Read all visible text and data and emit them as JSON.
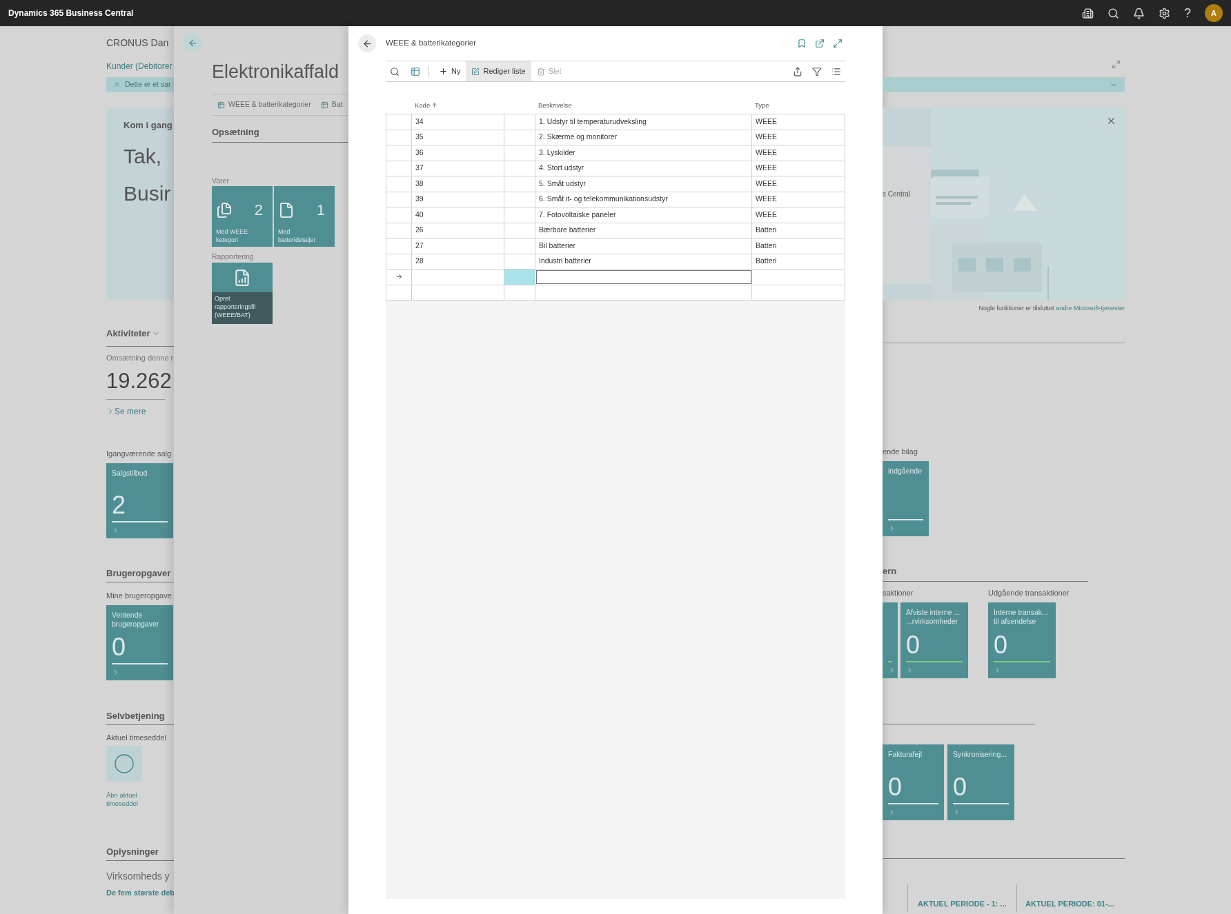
{
  "top_bar": {
    "title": "Dynamics 365 Business Central",
    "help": "?",
    "avatar": "A"
  },
  "home_left": {
    "company": "CRONUS Dan",
    "nav_link": "Kunder (Debitorer",
    "banner": "Dette er et sar",
    "kicker": "Kom i gang",
    "heading": [
      "Tak,",
      "Busir"
    ],
    "activities": {
      "title": "Aktiviteter",
      "caption": "Omsætning denne r",
      "value": "19.262",
      "link": "Se mere"
    },
    "sales": {
      "caption": "Igangværende salg",
      "tiles": [
        {
          "label": [
            "Salgstilbud"
          ],
          "value": "2",
          "color": "#d7e6e7"
        }
      ]
    },
    "tasks": {
      "title": "Brugeropgaver",
      "caption": "Mine brugeropgave",
      "tiles": [
        {
          "label": [
            "Ventende",
            "brugeropgaver"
          ],
          "value": "0",
          "color": "#d7e6e7"
        }
      ]
    },
    "self_service": {
      "title": "Selvbetjening",
      "caption": "Aktuel timeseddel",
      "action": [
        "Åbn aktuel",
        "timeseddel"
      ]
    },
    "info": {
      "title": "Oplysninger",
      "subtitle": "Virksomheds y",
      "link": "De fem største deb"
    }
  },
  "panel": {
    "title": "Elektronikaffald",
    "tabs": [
      "WEEE & batterikategorier",
      "Bat"
    ],
    "section": "Opsætning",
    "groups": [
      {
        "caption": "Varer",
        "tiles": [
          {
            "kind": "cue",
            "label": [
              "Med WEEE",
              "kategori"
            ],
            "value": "2"
          },
          {
            "kind": "cue",
            "label": [
              "Med",
              "batteridetaljer"
            ],
            "value": "1"
          }
        ]
      },
      {
        "caption": "Rapportering",
        "tiles": [
          {
            "kind": "action",
            "label": [
              "Opret",
              "rapporteringsfil",
              "(WEEE/BAT)"
            ]
          }
        ]
      }
    ]
  },
  "dialog": {
    "title": "WEEE & batterikategorier",
    "actions": [
      {
        "label": "Ny",
        "highlighted": false,
        "disabled": false
      },
      {
        "label": "Rediger liste",
        "highlighted": true,
        "disabled": false
      },
      {
        "label": "Slet",
        "highlighted": false,
        "disabled": true
      }
    ],
    "columns": [
      {
        "label": "Kode",
        "sorted": true
      },
      {
        "label": "Beskrivelse",
        "sorted": false
      },
      {
        "label": "Type",
        "sorted": false
      }
    ],
    "rows": [
      {
        "code": "34",
        "description": "1. Udstyr til temperaturudveksling",
        "type": "WEEE"
      },
      {
        "code": "35",
        "description": "2. Skærme og monitorer",
        "type": "WEEE"
      },
      {
        "code": "36",
        "description": "3. Lyskilder",
        "type": "WEEE"
      },
      {
        "code": "37",
        "description": "4. Stort udstyr",
        "type": "WEEE"
      },
      {
        "code": "38",
        "description": "5. Småt udstyr",
        "type": "WEEE"
      },
      {
        "code": "39",
        "description": "6. Småt it- og telekommunikationsudstyr",
        "type": "WEEE"
      },
      {
        "code": "40",
        "description": "7. Fotovoltaiske paneler",
        "type": "WEEE"
      },
      {
        "code": "26",
        "description": "Bærbare batterier",
        "type": "Batteri"
      },
      {
        "code": "27",
        "description": "Bil batterier",
        "type": "Batteri"
      },
      {
        "code": "28",
        "description": "Industri batterier",
        "type": "Batteri"
      }
    ],
    "new_row": {
      "current": true
    }
  },
  "home_right": {
    "side_text": "s Central",
    "note": "Nogle funktioner er tilsluttet",
    "note_link": "andre Microsoft-tjenester",
    "documents": {
      "caption": "ende bilag",
      "tiles": [
        {
          "label": [
            "indgående"
          ],
          "color": "#d7e6e7"
        }
      ]
    },
    "intercompany": {
      "title": "ern",
      "groups": [
        {
          "caption": "saktioner",
          "tiles": [
            {
              "color": "#7ccf7a"
            },
            {
              "label": [
                "Afviste interne ...",
                "...rvirksomheder"
              ],
              "value": "0",
              "color": "#7ccf7a"
            }
          ]
        },
        {
          "caption": "Udgående transaktioner",
          "tiles": [
            {
              "label": [
                "Interne transak...",
                "til afsendelse"
              ],
              "value": "0",
              "color": "#7ccf7a"
            }
          ]
        }
      ]
    },
    "sync": {
      "tiles": [
        {
          "label": [
            "Fakturafejl"
          ],
          "value": "0",
          "color": "#d7e6e7"
        },
        {
          "label": [
            "Synkronisering..."
          ],
          "value": "0",
          "color": "#d7e6e7"
        }
      ]
    },
    "periods": [
      "AKTUEL PERIODE - 1: ...",
      "AKTUEL PERIODE: 01-..."
    ]
  }
}
